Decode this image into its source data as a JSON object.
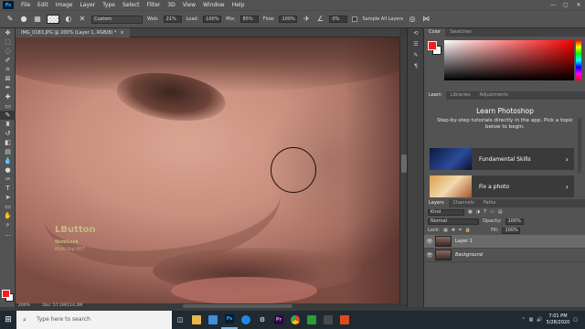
{
  "app": {
    "logo": "Ps"
  },
  "menu": [
    "File",
    "Edit",
    "Image",
    "Layer",
    "Type",
    "Select",
    "Filter",
    "3D",
    "View",
    "Window",
    "Help"
  ],
  "window_controls": [
    "—",
    "▢",
    "✕"
  ],
  "options_bar": {
    "preset": "Custom",
    "web_label": "Web:",
    "web_value": "21%",
    "load_label": "Load:",
    "load_value": "100%",
    "mix_label": "Mix:",
    "mix_value": "85%",
    "flow_label": "Flow:",
    "flow_value": "100%",
    "angle_value": "0%",
    "sample_label": "Sample All Layers"
  },
  "document": {
    "tab_title": "IMG_0183.JPG @ 200% (Layer 1, RGB/8) *",
    "close": "×"
  },
  "status": {
    "zoom": "200%",
    "doc": "Doc: 57.1M/114.2M"
  },
  "colors": {
    "foreground": "#ff1a1a",
    "background": "#ffffff",
    "accent": "#31a8ff"
  },
  "color_panel": {
    "tabs": [
      "Color",
      "Swatches"
    ]
  },
  "learn_panel": {
    "tabs": [
      "Learn",
      "Libraries",
      "Adjustments"
    ],
    "title": "Learn Photoshop",
    "description": "Step-by-step tutorials directly in the app. Pick a topic below to begin.",
    "cards": [
      {
        "title": "Fundamental Skills",
        "chevron": "›"
      },
      {
        "title": "Fix a photo",
        "chevron": "›"
      }
    ]
  },
  "layers_panel": {
    "tabs": [
      "Layers",
      "Channels",
      "Paths"
    ],
    "kind": "Kind",
    "blend_mode": "Normal",
    "opacity_label": "Opacity:",
    "opacity_value": "100%",
    "lock_label": "Lock:",
    "fill_label": "Fill:",
    "fill_value": "100%",
    "layers": [
      {
        "name": "Layer 1",
        "selected": true
      },
      {
        "name": "Background",
        "selected": false
      }
    ]
  },
  "overlay": {
    "big": "LButton",
    "line1": "NumLock",
    "line2": "Multi Raj 007"
  },
  "taskbar": {
    "search_placeholder": "Type here to search",
    "time": "7:01 PM",
    "date": "5/28/2020"
  }
}
